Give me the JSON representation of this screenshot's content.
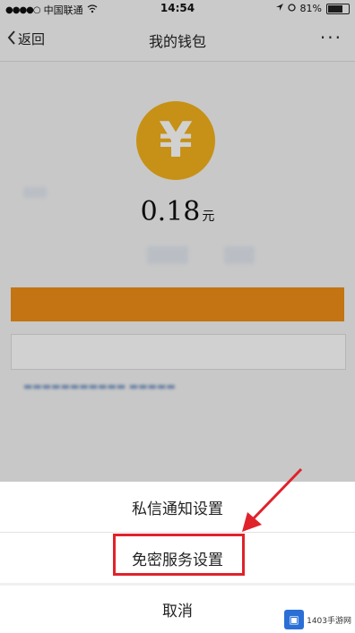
{
  "status_bar": {
    "carrier": "中国联通",
    "time": "14:54",
    "battery_percent": "81%",
    "battery_level": 0.81
  },
  "nav": {
    "back_label": "返回",
    "title": "我的钱包",
    "more_label": "···"
  },
  "wallet": {
    "coin_symbol": "¥",
    "balance": "0.18",
    "unit": "元"
  },
  "action_sheet": {
    "items": [
      {
        "label": "私信通知设置"
      },
      {
        "label": "免密服务设置"
      }
    ],
    "cancel_label": "取消"
  },
  "annotation": {
    "highlight_color": "#e0222b"
  },
  "watermark": {
    "text": "1403手游网"
  },
  "colors": {
    "coin": "#f2b11b",
    "primary_button": "#ef8e17"
  }
}
